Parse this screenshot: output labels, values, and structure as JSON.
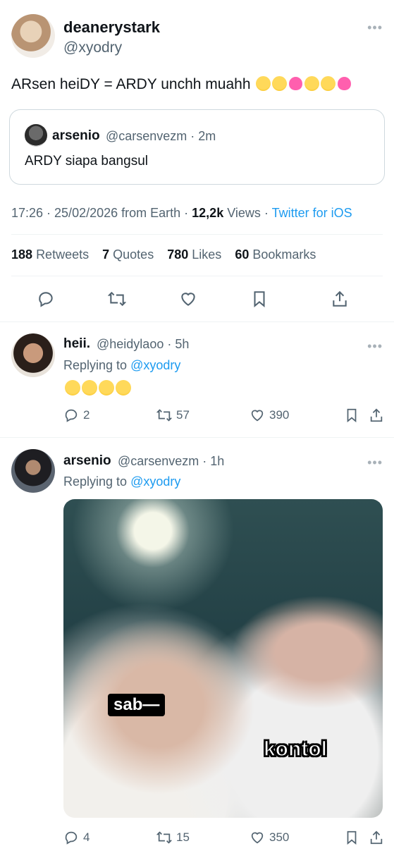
{
  "main_tweet": {
    "display_name": "deanerystark",
    "handle": "@xyodry",
    "text": "ARsen heiDY = ARDY unchh muahh",
    "emojis": [
      "face-hand-over-mouth",
      "smiling-face",
      "growing-heart",
      "face-blowing-kiss",
      "star-struck",
      "growing-heart"
    ],
    "quote": {
      "display_name": "arsenio",
      "handle_time": "@carsenvezm · 2m",
      "text": "ARDY siapa bangsul"
    },
    "meta": {
      "time_date": "17:26 · 25/02/2026 from Earth · ",
      "views_count": "12,2k",
      "views_label": " Views · ",
      "client": "Twitter for iOS"
    },
    "stats": {
      "retweets_count": "188",
      "retweets_label": "Retweets",
      "quotes_count": "7",
      "quotes_label": "Quotes",
      "likes_count": "780",
      "likes_label": "Likes",
      "bookmarks_count": "60",
      "bookmarks_label": "Bookmarks"
    }
  },
  "replies": [
    {
      "display_name": "heii.",
      "handle_time": "@heidylaoo · 5h",
      "replying_prefix": "Replying to ",
      "replying_to": "@xyodry",
      "emojis": [
        "loudly-crying-face",
        "loudly-crying-face",
        "loudly-crying-face",
        "loudly-crying-face"
      ],
      "reply_count": "2",
      "retweet_count": "57",
      "like_count": "390"
    },
    {
      "display_name": "arsenio",
      "handle_time": "@carsenvezm · 1h",
      "replying_prefix": "Replying to ",
      "replying_to": "@xyodry",
      "media_captions": [
        "sab—",
        "kontol"
      ],
      "reply_count": "4",
      "retweet_count": "15",
      "like_count": "350"
    }
  ],
  "icons": [
    "reply-icon",
    "retweet-icon",
    "like-icon",
    "bookmark-icon",
    "share-icon",
    "more-icon"
  ],
  "colors": {
    "link": "#1d9bf0",
    "secondary_text": "#536471",
    "divider": "#eff3f4"
  }
}
